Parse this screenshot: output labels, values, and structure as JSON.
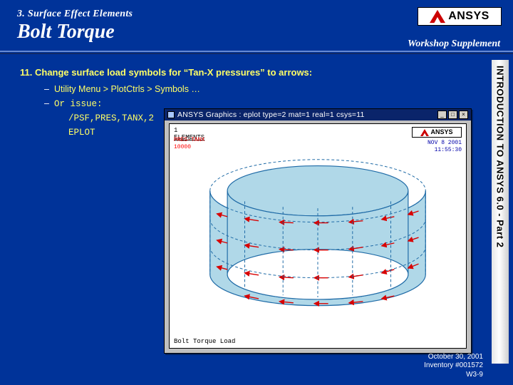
{
  "header": {
    "chapter": "3. Surface Effect Elements",
    "title": "Bolt Torque",
    "workshop_supplement": "Workshop Supplement",
    "logo_text": "ANSYS"
  },
  "sidebar": {
    "text": "INTRODUCTION TO ANSYS 6.0 - Part 2"
  },
  "step": {
    "number": "11.",
    "text": "Change surface load symbols for “Tan-X pressures” to arrows:",
    "bullets": {
      "a": "Utility Menu > PlotCtrls > Symbols …",
      "b": "Or issue:",
      "cmd1": "/PSF,PRES,TANX,2",
      "cmd2": "EPLOT"
    }
  },
  "screenshot": {
    "titlebar": "ANSYS Graphics : eplot  type=2 mat=1 real=1 csys=11",
    "btn_min": "_",
    "btn_max": "□",
    "btn_close": "×",
    "plot_label_tl_1": "1",
    "plot_label_tl_2": "ELEMENTS",
    "plot_load_1": "PRES-TANX",
    "plot_load_2": "10000",
    "plot_tr_line1": "NOV  8 2001",
    "plot_tr_line2": "11:55:30",
    "plot_bl": "Bolt Torque Load"
  },
  "footer": {
    "date": "October 30, 2001",
    "inventory": "Inventory #001572",
    "page": "W3-9"
  }
}
